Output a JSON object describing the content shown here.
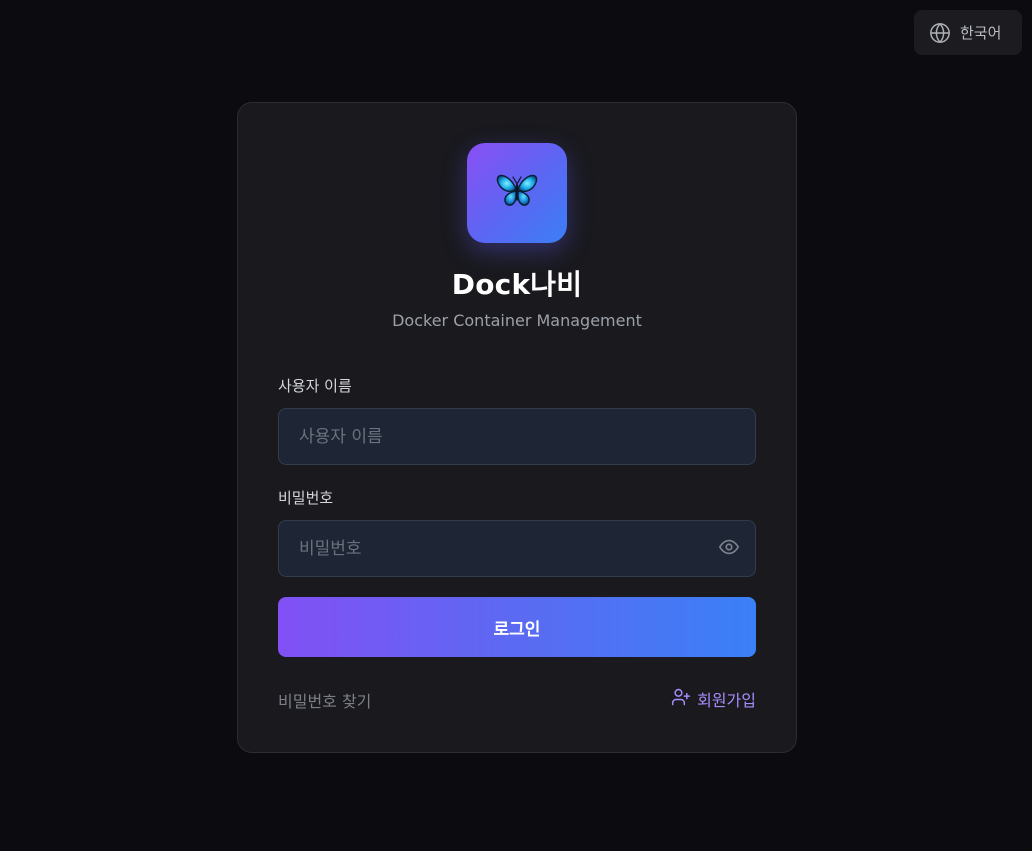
{
  "language": {
    "label": "한국어",
    "icon": "globe-icon"
  },
  "brand": {
    "logo_icon": "butterfly-icon",
    "title": "Dock나비",
    "subtitle": "Docker Container Management",
    "gradient_start": "#8b4ff5",
    "gradient_end": "#3b7ff6"
  },
  "form": {
    "username": {
      "label": "사용자 이름",
      "placeholder": "사용자 이름",
      "value": ""
    },
    "password": {
      "label": "비밀번호",
      "placeholder": "비밀번호",
      "value": "",
      "toggle_icon": "eye-icon"
    },
    "login_label": "로그인"
  },
  "links": {
    "forgot_password": "비밀번호 찾기",
    "signup": "회원가입",
    "signup_icon": "user-plus-icon",
    "accent_color": "#a78bfa"
  }
}
